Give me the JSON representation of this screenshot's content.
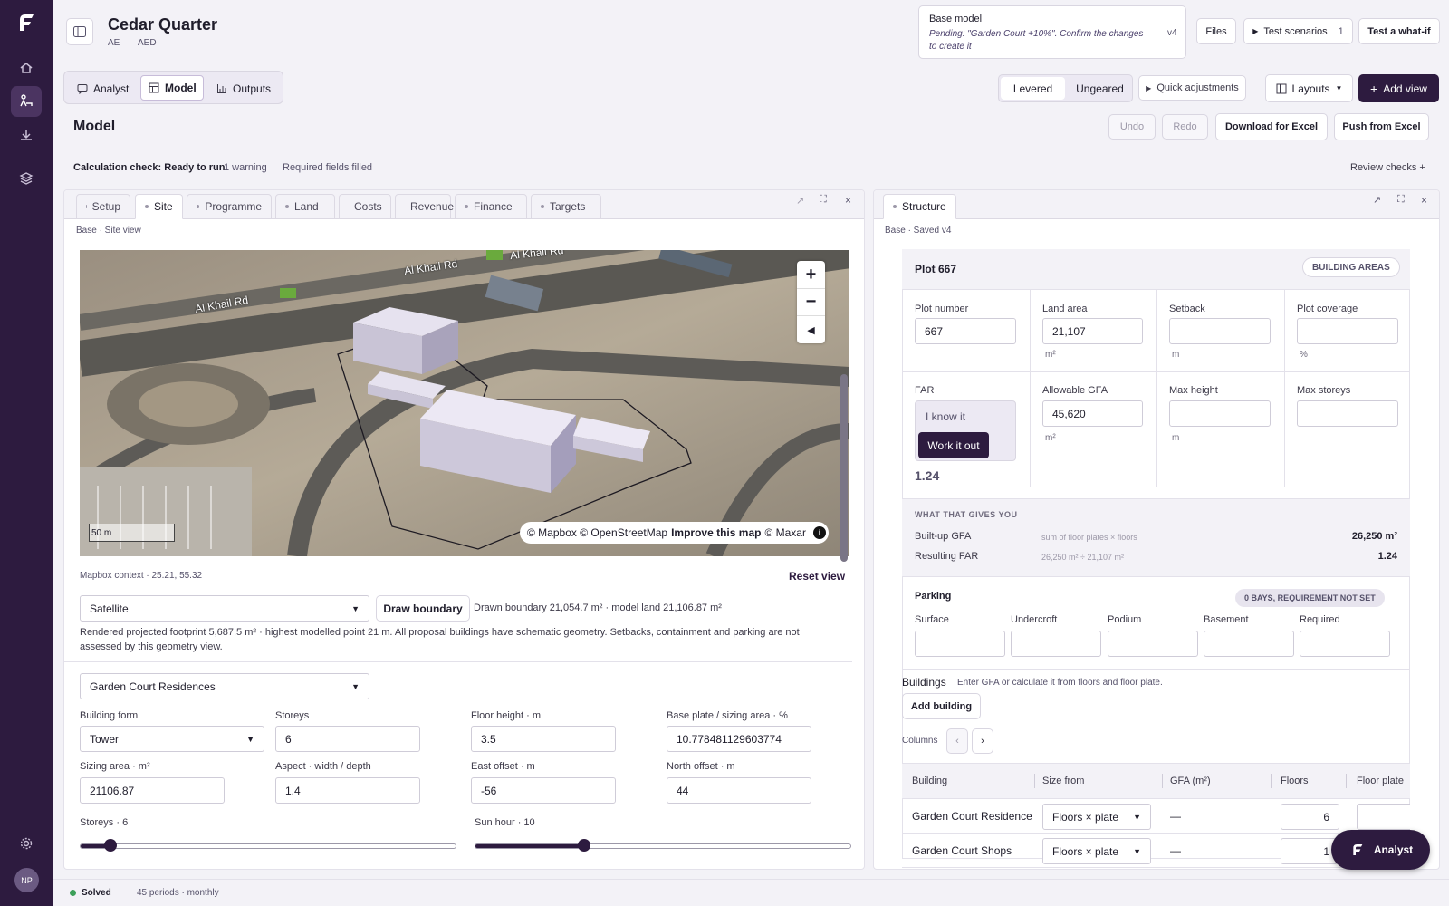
{
  "app": {
    "logo": "F",
    "avatar": "NP"
  },
  "header": {
    "title": "Cedar Quarter",
    "country": "AE",
    "currency": "AED",
    "base_model": {
      "title": "Base model",
      "pending": "Pending: \"Garden Court +10%\". Confirm the changes to create it",
      "version": "v4"
    },
    "files_label": "Files",
    "test_scenarios_label": "Test scenarios",
    "test_scenarios_count": "1",
    "what_if_label": "Test a what-if"
  },
  "mode_tabs": [
    {
      "label": "Analyst",
      "icon": "chat-icon"
    },
    {
      "label": "Model",
      "icon": "grid-icon"
    },
    {
      "label": "Outputs",
      "icon": "bar-chart-icon"
    }
  ],
  "toggle": {
    "levered": "Levered",
    "ungeared": "Ungeared"
  },
  "quick_adjust": "Quick adjustments",
  "layouts": "Layouts",
  "add_view": "Add view",
  "page_title": "Model",
  "actions": {
    "undo": "Undo",
    "redo": "Redo",
    "download": "Download for Excel",
    "push": "Push from Excel"
  },
  "calc": {
    "status": "Calculation check: Ready to run",
    "warnings": "1 warning",
    "fields": "Required fields filled",
    "review": "Review checks"
  },
  "left_panel": {
    "tabs": [
      "Setup",
      "Site",
      "Programme",
      "Land",
      "Costs",
      "Revenue",
      "Finance",
      "Targets"
    ],
    "breadcrumb": "Base · Site view",
    "map": {
      "road1": "Al Khail Rd",
      "road2": "Al Khail Rd",
      "road3": "Al Khail Rd",
      "scale": "50 m",
      "attribution": "© Mapbox © OpenStreetMap",
      "improve": "Improve this map",
      "maxar": "© Maxar",
      "zoom_in": "+",
      "zoom_out": "−"
    },
    "context": "Mapbox context · 25.21, 55.32",
    "reset": "Reset view",
    "basemap": "Satellite",
    "draw_boundary": "Draw boundary",
    "boundary_info": "Drawn boundary 21,054.7 m² · model land 21,106.87 m²",
    "note": "Rendered projected footprint 5,687.5 m² · highest modelled point 21 m. All proposal buildings have schematic geometry. Setbacks, containment and parking are not assessed by this geometry view.",
    "building_select": "Garden Court Residences",
    "fields": {
      "building_form": {
        "label": "Building form",
        "value": "Tower"
      },
      "storeys": {
        "label": "Storeys",
        "value": "6"
      },
      "floor_height": {
        "label": "Floor height · m",
        "value": "3.5"
      },
      "base_plate": {
        "label": "Base plate / sizing area · %",
        "value": "10.778481129603774"
      },
      "sizing_area": {
        "label": "Sizing area · m²",
        "value": "21106.87"
      },
      "aspect": {
        "label": "Aspect · width / depth",
        "value": "1.4"
      },
      "east_offset": {
        "label": "East offset · m",
        "value": "-56"
      },
      "north_offset": {
        "label": "North offset · m",
        "value": "44"
      }
    },
    "sliders": {
      "storeys_label": "Storeys · 6",
      "storeys_value": 0.08,
      "sun_label": "Sun hour · 10",
      "sun_value": 0.29
    }
  },
  "right_panel": {
    "tab": "Structure",
    "breadcrumb": "Base · Saved v4",
    "plot": {
      "title": "Plot 667",
      "badge": "BUILDING AREAS",
      "plot_number": {
        "label": "Plot number",
        "value": "667"
      },
      "land_area": {
        "label": "Land area",
        "value": "21,107",
        "unit": "m²"
      },
      "setback": {
        "label": "Setback",
        "value": "",
        "unit": "m"
      },
      "coverage": {
        "label": "Plot coverage",
        "value": "",
        "unit": "%"
      },
      "far": {
        "label": "FAR",
        "know": "I know it",
        "work": "Work it out",
        "value": "1.24"
      },
      "allowable_gfa": {
        "label": "Allowable GFA",
        "value": "45,620",
        "unit": "m²"
      },
      "max_height": {
        "label": "Max height",
        "value": "",
        "unit": "m"
      },
      "max_storeys": {
        "label": "Max storeys",
        "value": ""
      }
    },
    "gives": {
      "title": "WHAT THAT GIVES YOU",
      "rows": [
        {
          "label": "Built-up GFA",
          "formula": "sum of floor plates × floors",
          "value": "26,250 m²"
        },
        {
          "label": "Resulting FAR",
          "formula": "26,250 m² ÷ 21,107 m²",
          "value": "1.24"
        }
      ]
    },
    "parking": {
      "title": "Parking",
      "badge": "0 BAYS, REQUIREMENT NOT SET",
      "cols": [
        "Surface",
        "Undercroft",
        "Podium",
        "Basement",
        "Required"
      ]
    },
    "buildings": {
      "title": "Buildings",
      "hint": "Enter GFA or calculate it from floors and floor plate.",
      "add": "Add building",
      "columns_label": "Columns",
      "headers": [
        "Building",
        "Size from",
        "GFA (m²)",
        "Floors",
        "Floor plate"
      ],
      "rows": [
        {
          "name": "Garden Court Residences",
          "size": "Floors × plate",
          "gfa": "—",
          "floors": "6"
        },
        {
          "name": "Garden Court Shops",
          "size": "Floors × plate",
          "gfa": "—",
          "floors": "1"
        }
      ]
    }
  },
  "analyst_fab": "Analyst",
  "status": {
    "state": "Solved",
    "periods": "45 periods · monthly"
  }
}
